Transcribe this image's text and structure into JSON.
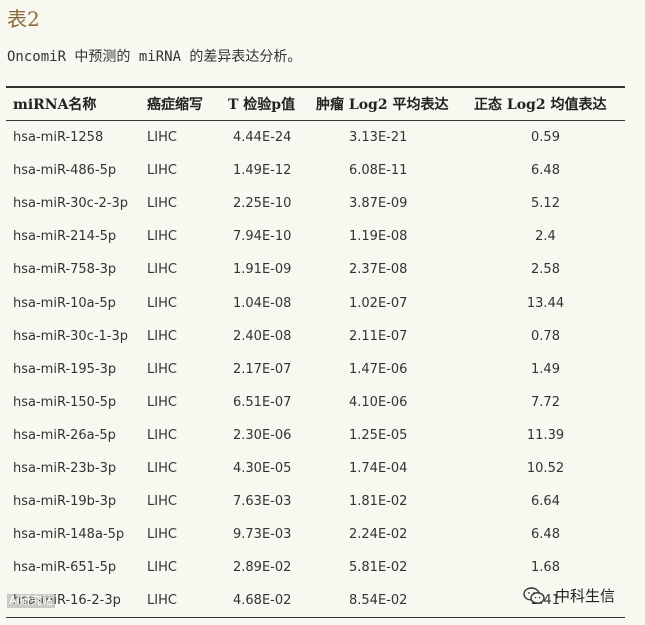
{
  "caption": {
    "title": "表2",
    "description": "OncomiR 中预测的 miRNA 的差异表达分析。"
  },
  "table": {
    "headers": [
      "miRNA名称",
      "癌症缩写",
      "T 检验p值",
      "肿瘤 Log2 平均表达",
      "正态 Log2 均值表达"
    ],
    "rows": [
      [
        "hsa-miR-1258",
        "LIHC",
        "4.44E-24",
        "3.13E-21",
        "0.59"
      ],
      [
        "hsa-miR-486-5p",
        "LIHC",
        "1.49E-12",
        "6.08E-11",
        "6.48"
      ],
      [
        "hsa-miR-30c-2-3p",
        "LIHC",
        "2.25E-10",
        "3.87E-09",
        "5.12"
      ],
      [
        "hsa-miR-214-5p",
        "LIHC",
        "7.94E-10",
        "1.19E-08",
        "2.4"
      ],
      [
        "hsa-miR-758-3p",
        "LIHC",
        "1.91E-09",
        "2.37E-08",
        "2.58"
      ],
      [
        "hsa-miR-10a-5p",
        "LIHC",
        "1.04E-08",
        "1.02E-07",
        "13.44"
      ],
      [
        "hsa-miR-30c-1-3p",
        "LIHC",
        "2.40E-08",
        "2.11E-07",
        "0.78"
      ],
      [
        "hsa-miR-195-3p",
        "LIHC",
        "2.17E-07",
        "1.47E-06",
        "1.49"
      ],
      [
        "hsa-miR-150-5p",
        "LIHC",
        "6.51E-07",
        "4.10E-06",
        "7.72"
      ],
      [
        "hsa-miR-26a-5p",
        "LIHC",
        "2.30E-06",
        "1.25E-05",
        "11.39"
      ],
      [
        "hsa-miR-23b-3p",
        "LIHC",
        "4.30E-05",
        "1.74E-04",
        "10.52"
      ],
      [
        "hsa-miR-19b-3p",
        "LIHC",
        "7.63E-03",
        "1.81E-02",
        "6.64"
      ],
      [
        "hsa-miR-148a-5p",
        "LIHC",
        "9.73E-03",
        "2.24E-02",
        "6.48"
      ],
      [
        "hsa-miR-651-5p",
        "LIHC",
        "2.89E-02",
        "5.81E-02",
        "1.68"
      ],
      [
        "hsa-miR-16-2-3p",
        "LIHC",
        "4.68E-02",
        "8.54E-02",
        "2.41"
      ]
    ]
  },
  "watermark": {
    "left_text": "AI研究站",
    "right_text": "中科生信",
    "icon": "wechat-icon"
  }
}
